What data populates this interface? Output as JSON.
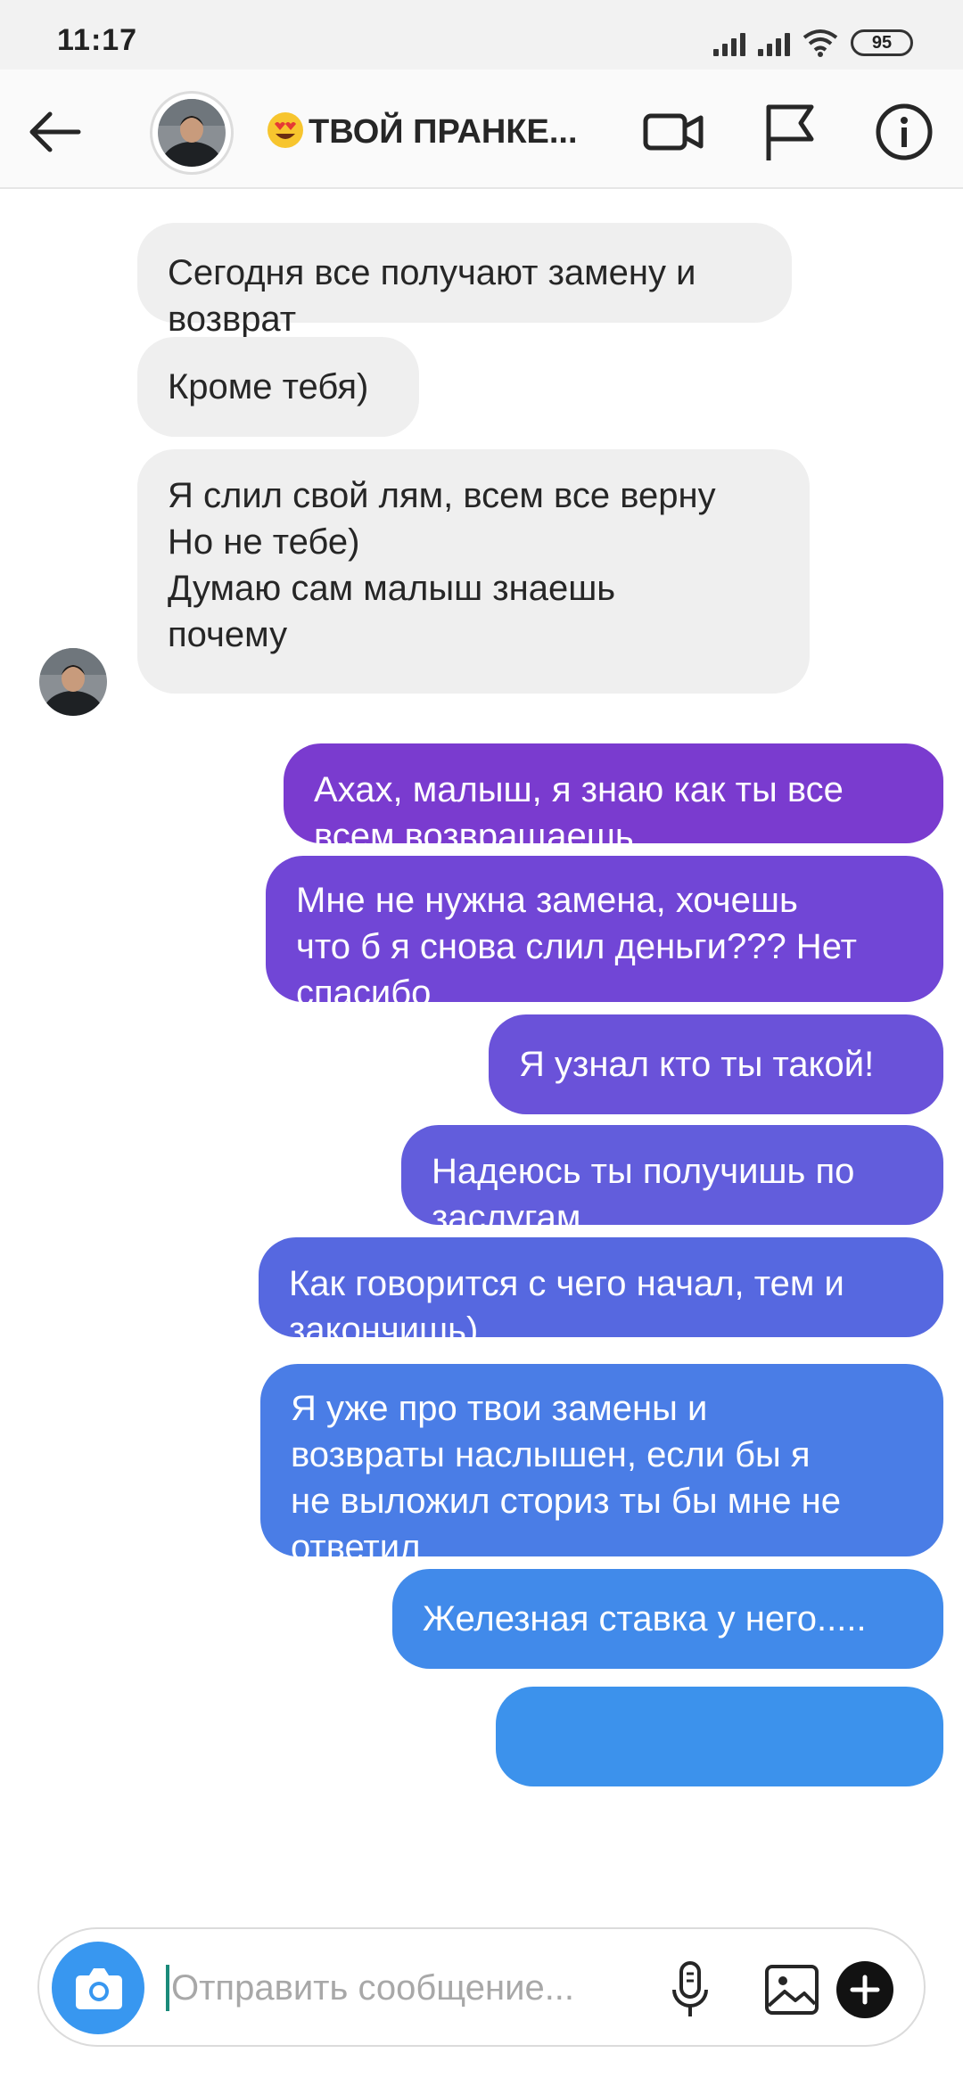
{
  "status_bar": {
    "time": "11:17",
    "battery": "95"
  },
  "header": {
    "title": "ТВОЙ ПРАНКЕ..."
  },
  "messages": [
    {
      "dir": "in",
      "text": "Сегодня все получают замену и\nвозврат"
    },
    {
      "dir": "in",
      "text": "Кроме тебя)"
    },
    {
      "dir": "in",
      "text": "Я слил свой лям, всем все верну\nНо не тебе)\nДумаю сам малыш знаешь\nпочему"
    },
    {
      "dir": "out",
      "text": "Ахах, малыш, я знаю как ты все\nвсем возвращаешь"
    },
    {
      "dir": "out",
      "text": "Мне не нужна замена, хочешь\nчто б я снова слил деньги??? Нет\nспасибо"
    },
    {
      "dir": "out",
      "text": "Я узнал кто ты такой!"
    },
    {
      "dir": "out",
      "text": "Надеюсь ты получишь по\nзаслугам"
    },
    {
      "dir": "out",
      "text": "Как говорится с чего начал, тем и\nзакончишь)"
    },
    {
      "dir": "out",
      "text": "Я уже про твои замены и\nвозвраты наслышен, если бы я\nне выложил сториз ты бы мне не\nответил"
    },
    {
      "dir": "out",
      "text": "Железная ставка у него....."
    },
    {
      "dir": "out",
      "text": ""
    }
  ],
  "composer": {
    "placeholder": "Отправить сообщение..."
  },
  "colors": {
    "incoming_bubble": "#efefef",
    "outgoing_gradient_top": "#7c3acc",
    "outgoing_gradient_bottom": "#3b8fe8",
    "camera_button": "#3897f0"
  }
}
